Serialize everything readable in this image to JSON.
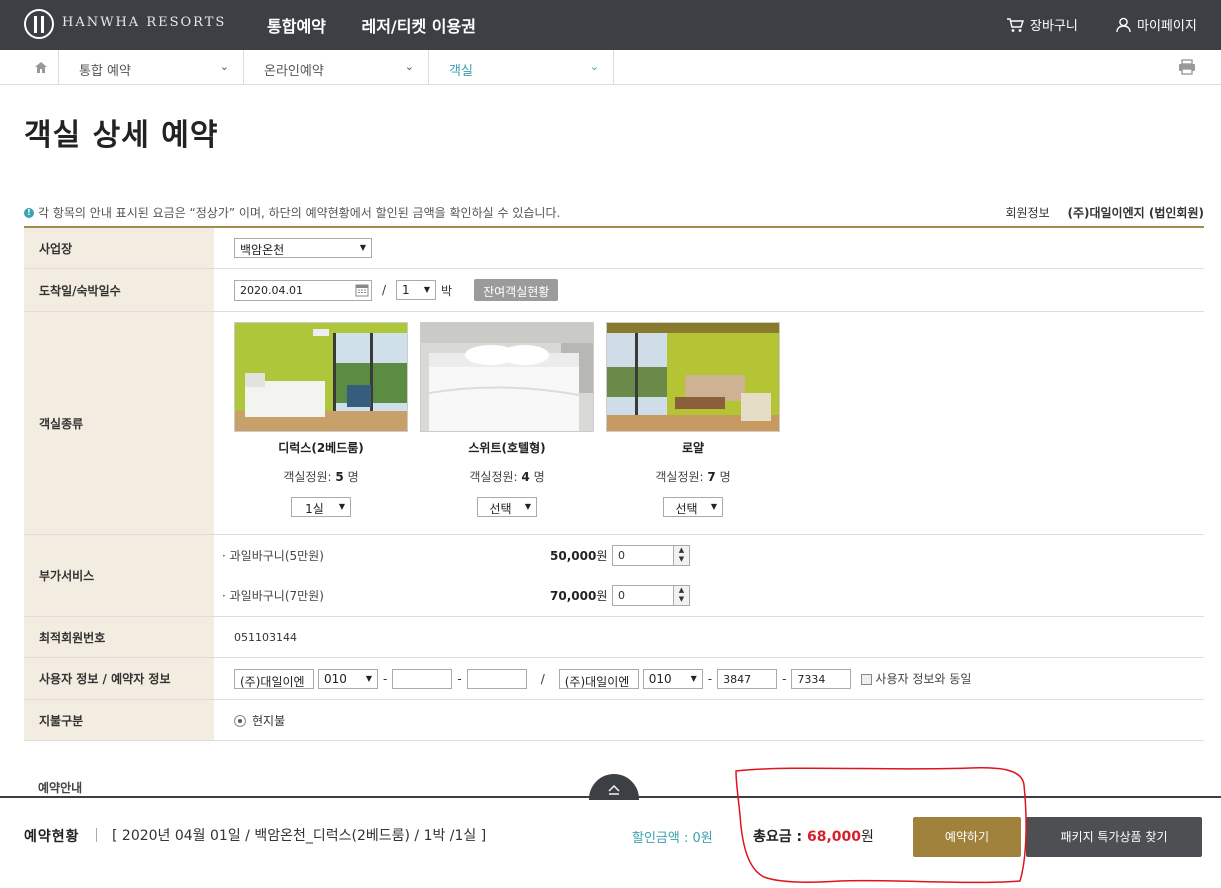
{
  "header": {
    "logo_text": "HANWHA RESORTS",
    "menu": [
      "통합예약",
      "레저/티켓 이용권"
    ],
    "cart_label": "장바구니",
    "mypage_label": "마이페이지"
  },
  "breadcrumb": {
    "items": [
      "통합 예약",
      "온라인예약",
      "객실"
    ]
  },
  "page_title": "객실 상세 예약",
  "notice": "각 항목의 안내 표시된 요금은 “정상가” 이며, 하단의 예약현황에서 할인된 금액을 확인하실 수 있습니다.",
  "member": {
    "label": "회원정보",
    "value": "(주)대일이엔지 (법인회원)"
  },
  "form": {
    "site": {
      "label": "사업장",
      "value": "백암온천"
    },
    "arrival": {
      "label": "도착일/숙박일수",
      "date": "2020.04.01",
      "slash": "/",
      "nights": "1",
      "nights_unit": "박",
      "availability_btn": "잔여객실현황"
    },
    "rooms": {
      "label": "객실종류",
      "cap_label": "객실정원:",
      "cap_unit": "명",
      "items": [
        {
          "name": "디럭스(2베드룸)",
          "capacity": "5",
          "selected": "1실"
        },
        {
          "name": "스위트(호텔형)",
          "capacity": "4",
          "selected": "선택"
        },
        {
          "name": "로얄",
          "capacity": "7",
          "selected": "선택"
        }
      ]
    },
    "extras": {
      "label": "부가서비스",
      "items": [
        {
          "name": "· 과일바구니(5만원)",
          "price": "50,000",
          "unit": "원",
          "qty": "0"
        },
        {
          "name": "· 과일바구니(7만원)",
          "price": "70,000",
          "unit": "원",
          "qty": "0"
        }
      ]
    },
    "member_no": {
      "label": "최적회원번호",
      "value": "051103144"
    },
    "user_info": {
      "label": "사용자 정보 / 예약자 정보",
      "user_name": "(주)대일이엔",
      "user_phone1": "010",
      "user_phone2": "",
      "user_phone3": "",
      "booker_name": "(주)대일이엔",
      "booker_phone1": "010",
      "booker_phone2": "3847",
      "booker_phone3": "7334",
      "dash": "-",
      "slash": "/",
      "same_label": "사용자 정보와 동일"
    },
    "payment": {
      "label": "지불구분",
      "value": "현지불"
    }
  },
  "guide_title": "예약안내",
  "bottom": {
    "label": "예약현황",
    "summary": "[ 2020년 04월 01일 / 백암온천_디럭스(2베드룸) / 1박 /1실 ]",
    "discount": "할인금액 : 0원",
    "total_label": "총요금 : ",
    "total_amount": "68,000",
    "total_unit": "원",
    "reserve_btn": "예약하기",
    "package_btn": "패키지 특가상품 찾기"
  },
  "colors": {
    "topbar": "#3c3f44",
    "accent_gold": "#a0823d",
    "accent_teal": "#3aa2b0",
    "total_red": "#d71f28",
    "annotation_red": "#e0141e"
  }
}
